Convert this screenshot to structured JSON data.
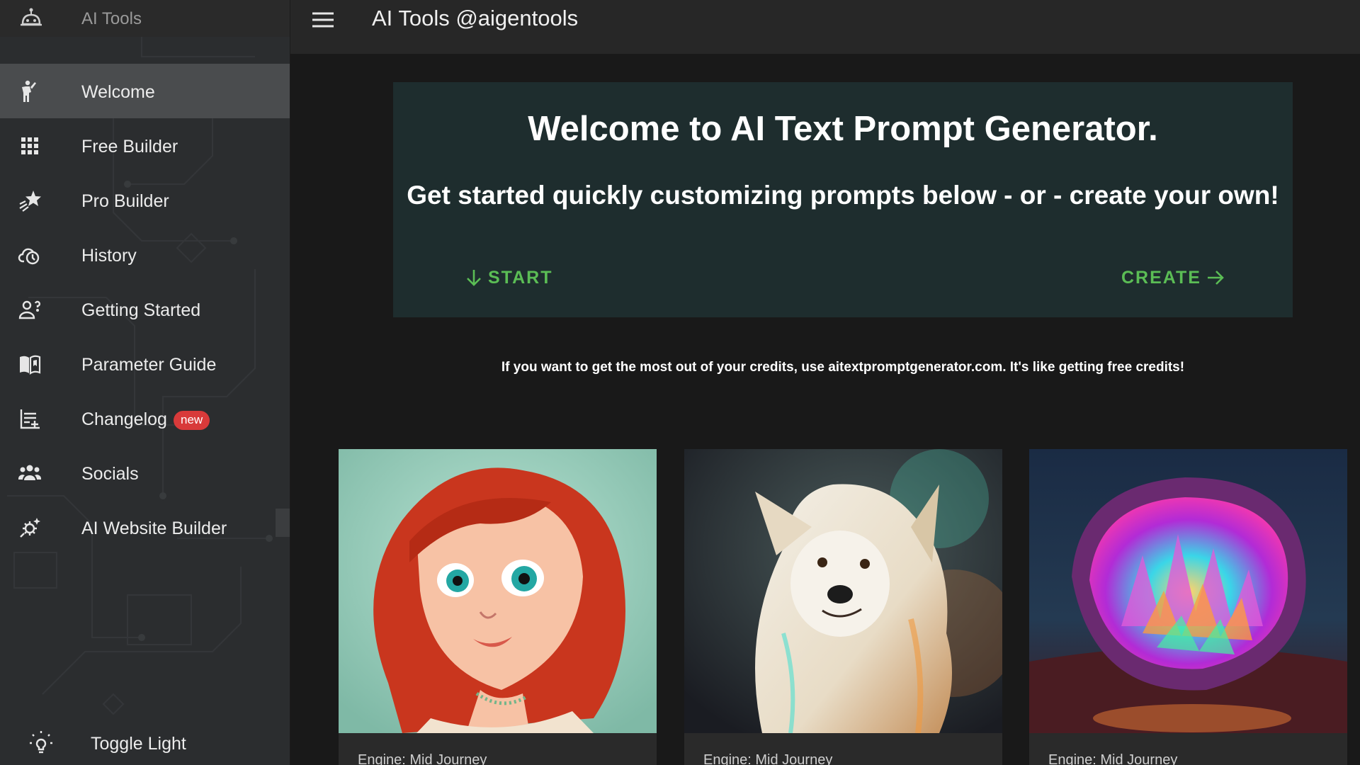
{
  "sidebar": {
    "app_title": "AI Tools",
    "items": [
      {
        "label": "Welcome",
        "icon": "person-wave-icon",
        "active": true
      },
      {
        "label": "Free Builder",
        "icon": "grid-icon"
      },
      {
        "label": "Pro Builder",
        "icon": "shooting-star-icon"
      },
      {
        "label": "History",
        "icon": "cloud-history-icon"
      },
      {
        "label": "Getting Started",
        "icon": "person-question-icon"
      },
      {
        "label": "Parameter Guide",
        "icon": "book-icon"
      },
      {
        "label": "Changelog",
        "icon": "list-add-icon",
        "badge": "new"
      },
      {
        "label": "Socials",
        "icon": "group-icon"
      },
      {
        "label": "AI Website Builder",
        "icon": "settings-spark-icon"
      }
    ],
    "toggle_label": "Toggle Light"
  },
  "topbar": {
    "title": "AI Tools @aigentools"
  },
  "hero": {
    "heading": "Welcome to AI Text Prompt Generator.",
    "subheading": "Get started quickly customizing prompts below - or - create your own!",
    "start_label": "START",
    "create_label": "CREATE"
  },
  "credit_note": "If you want to get the most out of your credits, use aitextpromptgenerator.com. It's like getting free credits!",
  "cards": [
    {
      "engine": "Engine: Mid Journey",
      "subject": "red-haired cartoon girl"
    },
    {
      "engine": "Engine: Mid Journey",
      "subject": "glowing white dog"
    },
    {
      "engine": "Engine: Mid Journey",
      "subject": "neon crystal geode"
    }
  ],
  "colors": {
    "accent_green": "#5bbd55",
    "badge_red": "#d83a3a",
    "hero_bg": "#1e2d2e",
    "page_bg": "#191919",
    "sidebar_bg": "#2b2d2f"
  }
}
